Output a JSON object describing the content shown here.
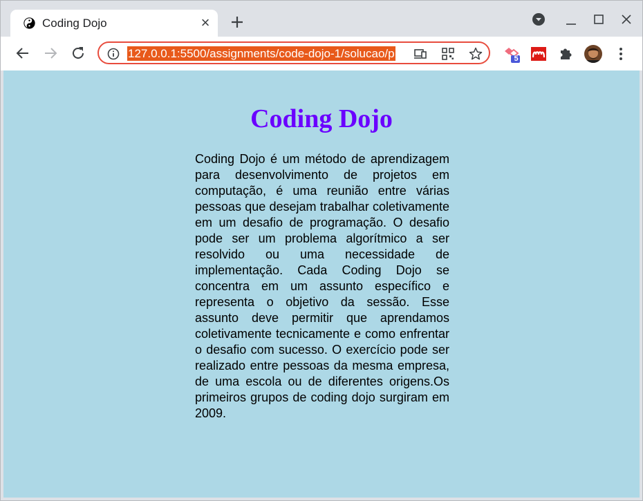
{
  "browser": {
    "tab": {
      "title": "Coding Dojo"
    },
    "address_bar": {
      "url": "127.0.0.1:5500/assignments/code-dojo-1/solucao/p"
    },
    "extension_badge": "5"
  },
  "page": {
    "heading": "Coding Dojo",
    "paragraph": "Coding Dojo é um método de aprendizagem para desenvolvimento de projetos em computação, é uma reunião entre várias pessoas que desejam trabalhar coletivamente em um desafio de programação. O desafio pode ser um problema algorítmico a ser resolvido ou uma necessidade de implementação. Cada Coding Dojo se concentra em um assunto específico e representa o objetivo da sessão. Esse assunto deve permitir que aprendamos coletivamente tecnicamente e como enfrentar o desafio com sucesso. O exercício pode ser realizado entre pessoas da mesma empresa, de uma escola ou de diferentes origens.Os primeiros grupos de coding dojo surgiram em 2009."
  },
  "colors": {
    "page_background": "#add8e6",
    "heading": "#6a00ff",
    "url_highlight": "#e8591a",
    "omnibox_border": "#e84c3d"
  },
  "icons": {
    "tab_favicon": "yin-yang-icon",
    "tab_close": "close-icon",
    "new_tab": "plus-icon",
    "profile_menu": "chevron-down-circle-icon",
    "minimize": "minimize-icon",
    "maximize": "maximize-icon",
    "close_window": "close-icon",
    "back": "arrow-left-icon",
    "forward": "arrow-right-icon",
    "reload": "reload-icon",
    "site_info": "info-icon",
    "cast": "cast-icon",
    "qr": "qr-code-icon",
    "bookmark": "star-icon",
    "extension_1": "extension-badge-icon",
    "extension_2": "mendeley-icon",
    "extensions": "puzzle-icon",
    "menu": "kebab-menu-icon"
  }
}
